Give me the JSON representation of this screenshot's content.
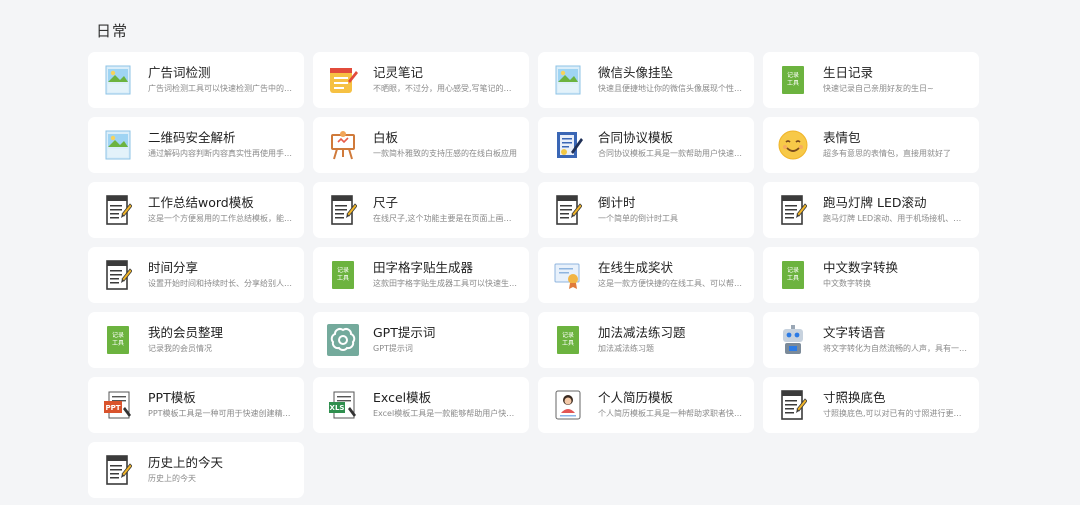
{
  "section": {
    "title": "日常"
  },
  "cards": [
    {
      "title": "广告词检测",
      "desc": "广告词检测工具可以快速检测广告中的敏感...",
      "icon": "image-icon"
    },
    {
      "title": "记灵笔记",
      "desc": "不晒眼，不过分，用心感受,写笔记的本质。遇...",
      "icon": "notepad-icon"
    },
    {
      "title": "微信头像挂坠",
      "desc": "快速且便捷地让你的微信头像展现个性。品...",
      "icon": "image-icon"
    },
    {
      "title": "生日记录",
      "desc": "快速记录自己亲朋好友的生日~",
      "icon": "record-tool-icon"
    },
    {
      "title": "二维码安全解析",
      "desc": "通过解码内容判断内容真实性再使用手机扫...",
      "icon": "image-icon"
    },
    {
      "title": "白板",
      "desc": "一款简朴雅致的支持压感的在线白板应用",
      "icon": "whiteboard-icon"
    },
    {
      "title": "合同协议模板",
      "desc": "合同协议模板工具是一款帮助用户快速生成...",
      "icon": "contract-icon"
    },
    {
      "title": "表情包",
      "desc": "超多有意思的表情包，直接用就好了",
      "icon": "emoji-icon"
    },
    {
      "title": "工作总结word模板",
      "desc": "这是一个方便易用的工作总结模板，能够帮...",
      "icon": "document-icon"
    },
    {
      "title": "尺子",
      "desc": "在线尺子,这个功能主要是在页面上画使用",
      "icon": "document-icon"
    },
    {
      "title": "倒计时",
      "desc": "一个简单的倒计时工具",
      "icon": "document-icon"
    },
    {
      "title": "跑马灯牌 LED滚动",
      "desc": "跑马灯牌 LED滚动、用于机场接机、粉丝应援",
      "icon": "document-icon"
    },
    {
      "title": "时间分享",
      "desc": "设置开始时间和持续时长、分享给别人、一...",
      "icon": "document-icon"
    },
    {
      "title": "田字格字贴生成器",
      "desc": "这款田字格字贴生成器工具可以快速生成定...",
      "icon": "record-tool-icon"
    },
    {
      "title": "在线生成奖状",
      "desc": "这是一款方便快捷的在线工具、可以帮助您...",
      "icon": "certificate-icon"
    },
    {
      "title": "中文数字转换",
      "desc": "中文数字转换",
      "icon": "record-tool-icon"
    },
    {
      "title": "我的会员整理",
      "desc": "记录我的会员情况",
      "icon": "record-tool-icon"
    },
    {
      "title": "GPT提示词",
      "desc": "GPT提示词",
      "icon": "openai-icon"
    },
    {
      "title": "加法减法练习题",
      "desc": "加法减法练习题",
      "icon": "record-tool-icon"
    },
    {
      "title": "文字转语音",
      "desc": "将文字转化为自然流畅的人声，具有一定的...",
      "icon": "robot-icon"
    },
    {
      "title": "PPT模板",
      "desc": "PPT模板工具是一种可用于快速创建精美的演...",
      "icon": "ppt-icon"
    },
    {
      "title": "Excel模板",
      "desc": "Excel模板工具是一款能够帮助用户快速创建...",
      "icon": "excel-icon"
    },
    {
      "title": "个人简历模板",
      "desc": "个人简历模板工具是一种帮助求职者快速创...",
      "icon": "resume-icon"
    },
    {
      "title": "寸照换底色",
      "desc": "寸照换底色,可以对已有的寸照进行更换底色。",
      "icon": "document-icon"
    },
    {
      "title": "历史上的今天",
      "desc": "历史上的今天",
      "icon": "document-icon"
    }
  ],
  "icon_labels": {
    "record_tool": "记录\n工具"
  },
  "colors": {
    "background": "#f4f5f7",
    "card": "#ffffff",
    "green": "#6cb33f"
  }
}
